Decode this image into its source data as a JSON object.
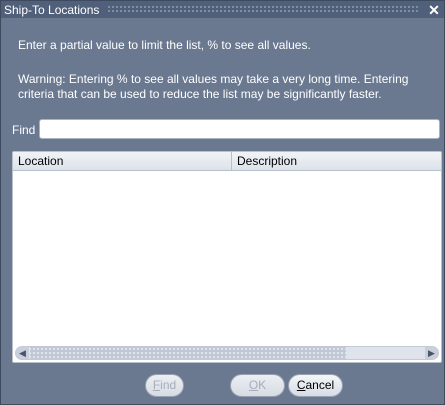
{
  "window": {
    "title": "Ship-To Locations",
    "close_symbol": "✕"
  },
  "messages": {
    "hint": "Enter a partial value to limit the list, % to see all values.",
    "warning": "Warning: Entering % to see all values may take a very long time. Entering criteria that can be used to reduce the list may be significantly faster."
  },
  "find": {
    "label": "Find",
    "value": "",
    "placeholder": ""
  },
  "list": {
    "columns": [
      "Location",
      "Description"
    ],
    "rows": []
  },
  "scrollbar": {
    "left_arrow": "◀",
    "right_arrow": "▶"
  },
  "buttons": {
    "find": {
      "first": "F",
      "rest": "ind",
      "enabled": false
    },
    "ok": {
      "first": "O",
      "rest": "K",
      "enabled": false
    },
    "cancel": {
      "first": "C",
      "rest": "ancel",
      "enabled": true
    }
  },
  "colors": {
    "dialog_bg": "#6a7890",
    "titlebar_bg": "#51607a",
    "text_light": "#ffffff"
  }
}
